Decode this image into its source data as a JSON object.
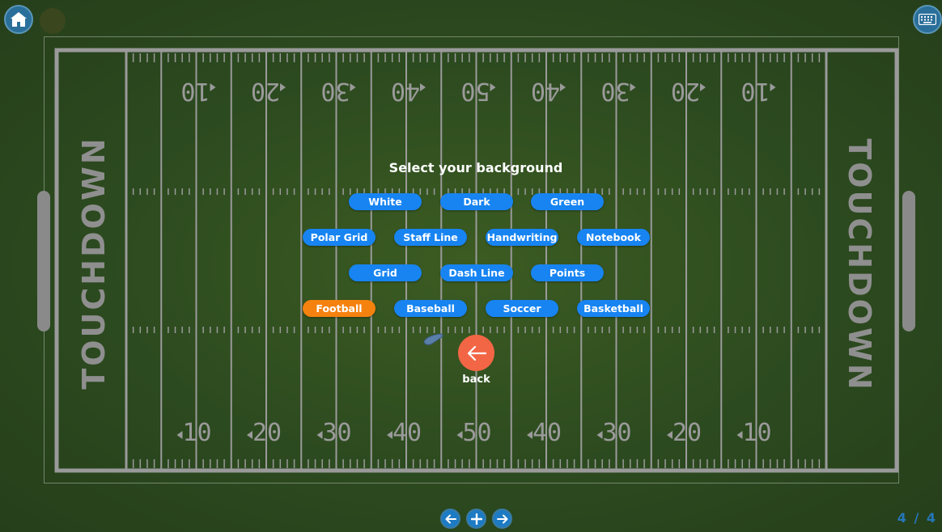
{
  "toolbar": {
    "home_icon": "home-icon",
    "keyboard_icon": "keyboard-icon"
  },
  "field": {
    "endzone_left_text": "TOUCHDOWN",
    "endzone_right_text": "TOUCHDOWN",
    "yard_numbers": [
      "10",
      "20",
      "30",
      "40",
      "50",
      "40",
      "30",
      "20",
      "10"
    ],
    "colors": {
      "grass": "#2c4a1f",
      "lines": "#9a9a9a"
    }
  },
  "panel": {
    "title": "Select your background",
    "options": [
      {
        "label": "White",
        "active": false
      },
      {
        "label": "Dark",
        "active": false
      },
      {
        "label": "Green",
        "active": false
      },
      {
        "label": "Polar Grid",
        "active": false
      },
      {
        "label": "Staff Line",
        "active": false
      },
      {
        "label": "Handwriting",
        "active": false
      },
      {
        "label": "Notebook",
        "active": false
      },
      {
        "label": "Grid",
        "active": false
      },
      {
        "label": "Dash Line",
        "active": false
      },
      {
        "label": "Points",
        "active": false
      },
      {
        "label": "Football",
        "active": true
      },
      {
        "label": "Baseball",
        "active": false
      },
      {
        "label": "Soccer",
        "active": false
      },
      {
        "label": "Basketball",
        "active": false
      }
    ],
    "back_label": "back",
    "colors": {
      "button": "#1784f2",
      "active": "#f5820f",
      "back": "#f26646"
    }
  },
  "bottom_nav": {
    "prev_icon": "arrow-left-icon",
    "add_icon": "plus-icon",
    "next_icon": "arrow-right-icon"
  },
  "page_indicator": "4 / 4"
}
